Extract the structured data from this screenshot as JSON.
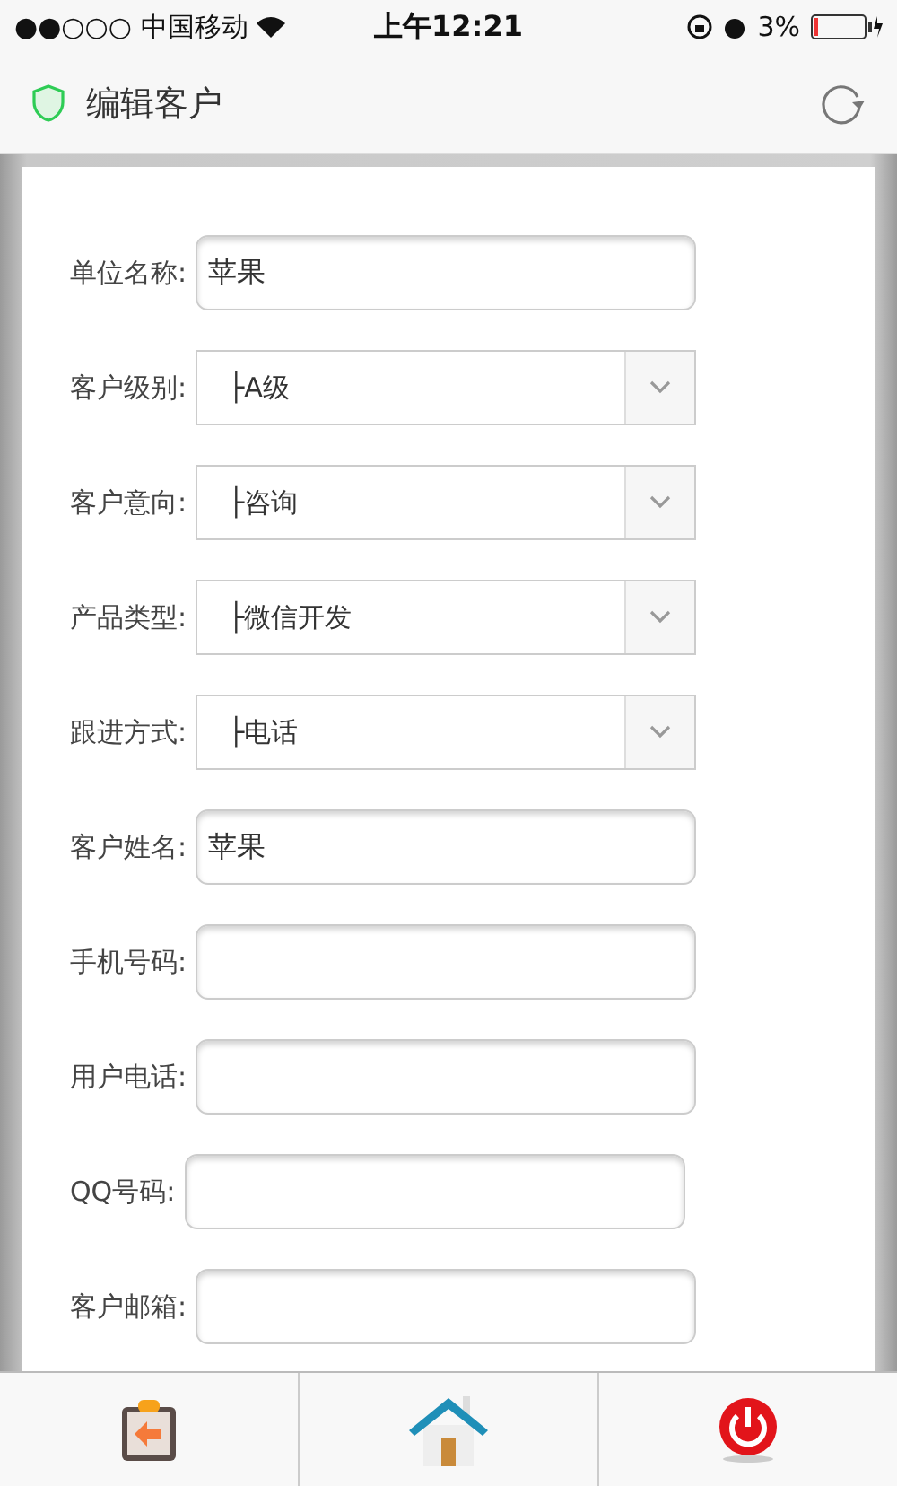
{
  "status_bar": {
    "signal": "●●○○○",
    "carrier": "中国移动",
    "time": "上午12:21",
    "battery": "3%"
  },
  "header": {
    "title": "编辑客户"
  },
  "form": {
    "fields": [
      {
        "kind": "text",
        "label": "单位名称:",
        "value": "苹果"
      },
      {
        "kind": "select",
        "label": "客户级别:",
        "value": "├A级"
      },
      {
        "kind": "select",
        "label": "客户意向:",
        "value": "├咨询"
      },
      {
        "kind": "select",
        "label": "产品类型:",
        "value": "├微信开发"
      },
      {
        "kind": "select",
        "label": "跟进方式:",
        "value": "├电话"
      },
      {
        "kind": "text",
        "label": "客户姓名:",
        "value": "苹果"
      },
      {
        "kind": "text",
        "label": "手机号码:"
      },
      {
        "kind": "text",
        "label": "用户电话:"
      },
      {
        "kind": "text",
        "label": "QQ号码:"
      },
      {
        "kind": "text",
        "label": "客户邮箱:"
      }
    ]
  },
  "tab_bar": [
    {
      "kind": "back"
    },
    {
      "kind": "home"
    },
    {
      "kind": "power"
    }
  ]
}
